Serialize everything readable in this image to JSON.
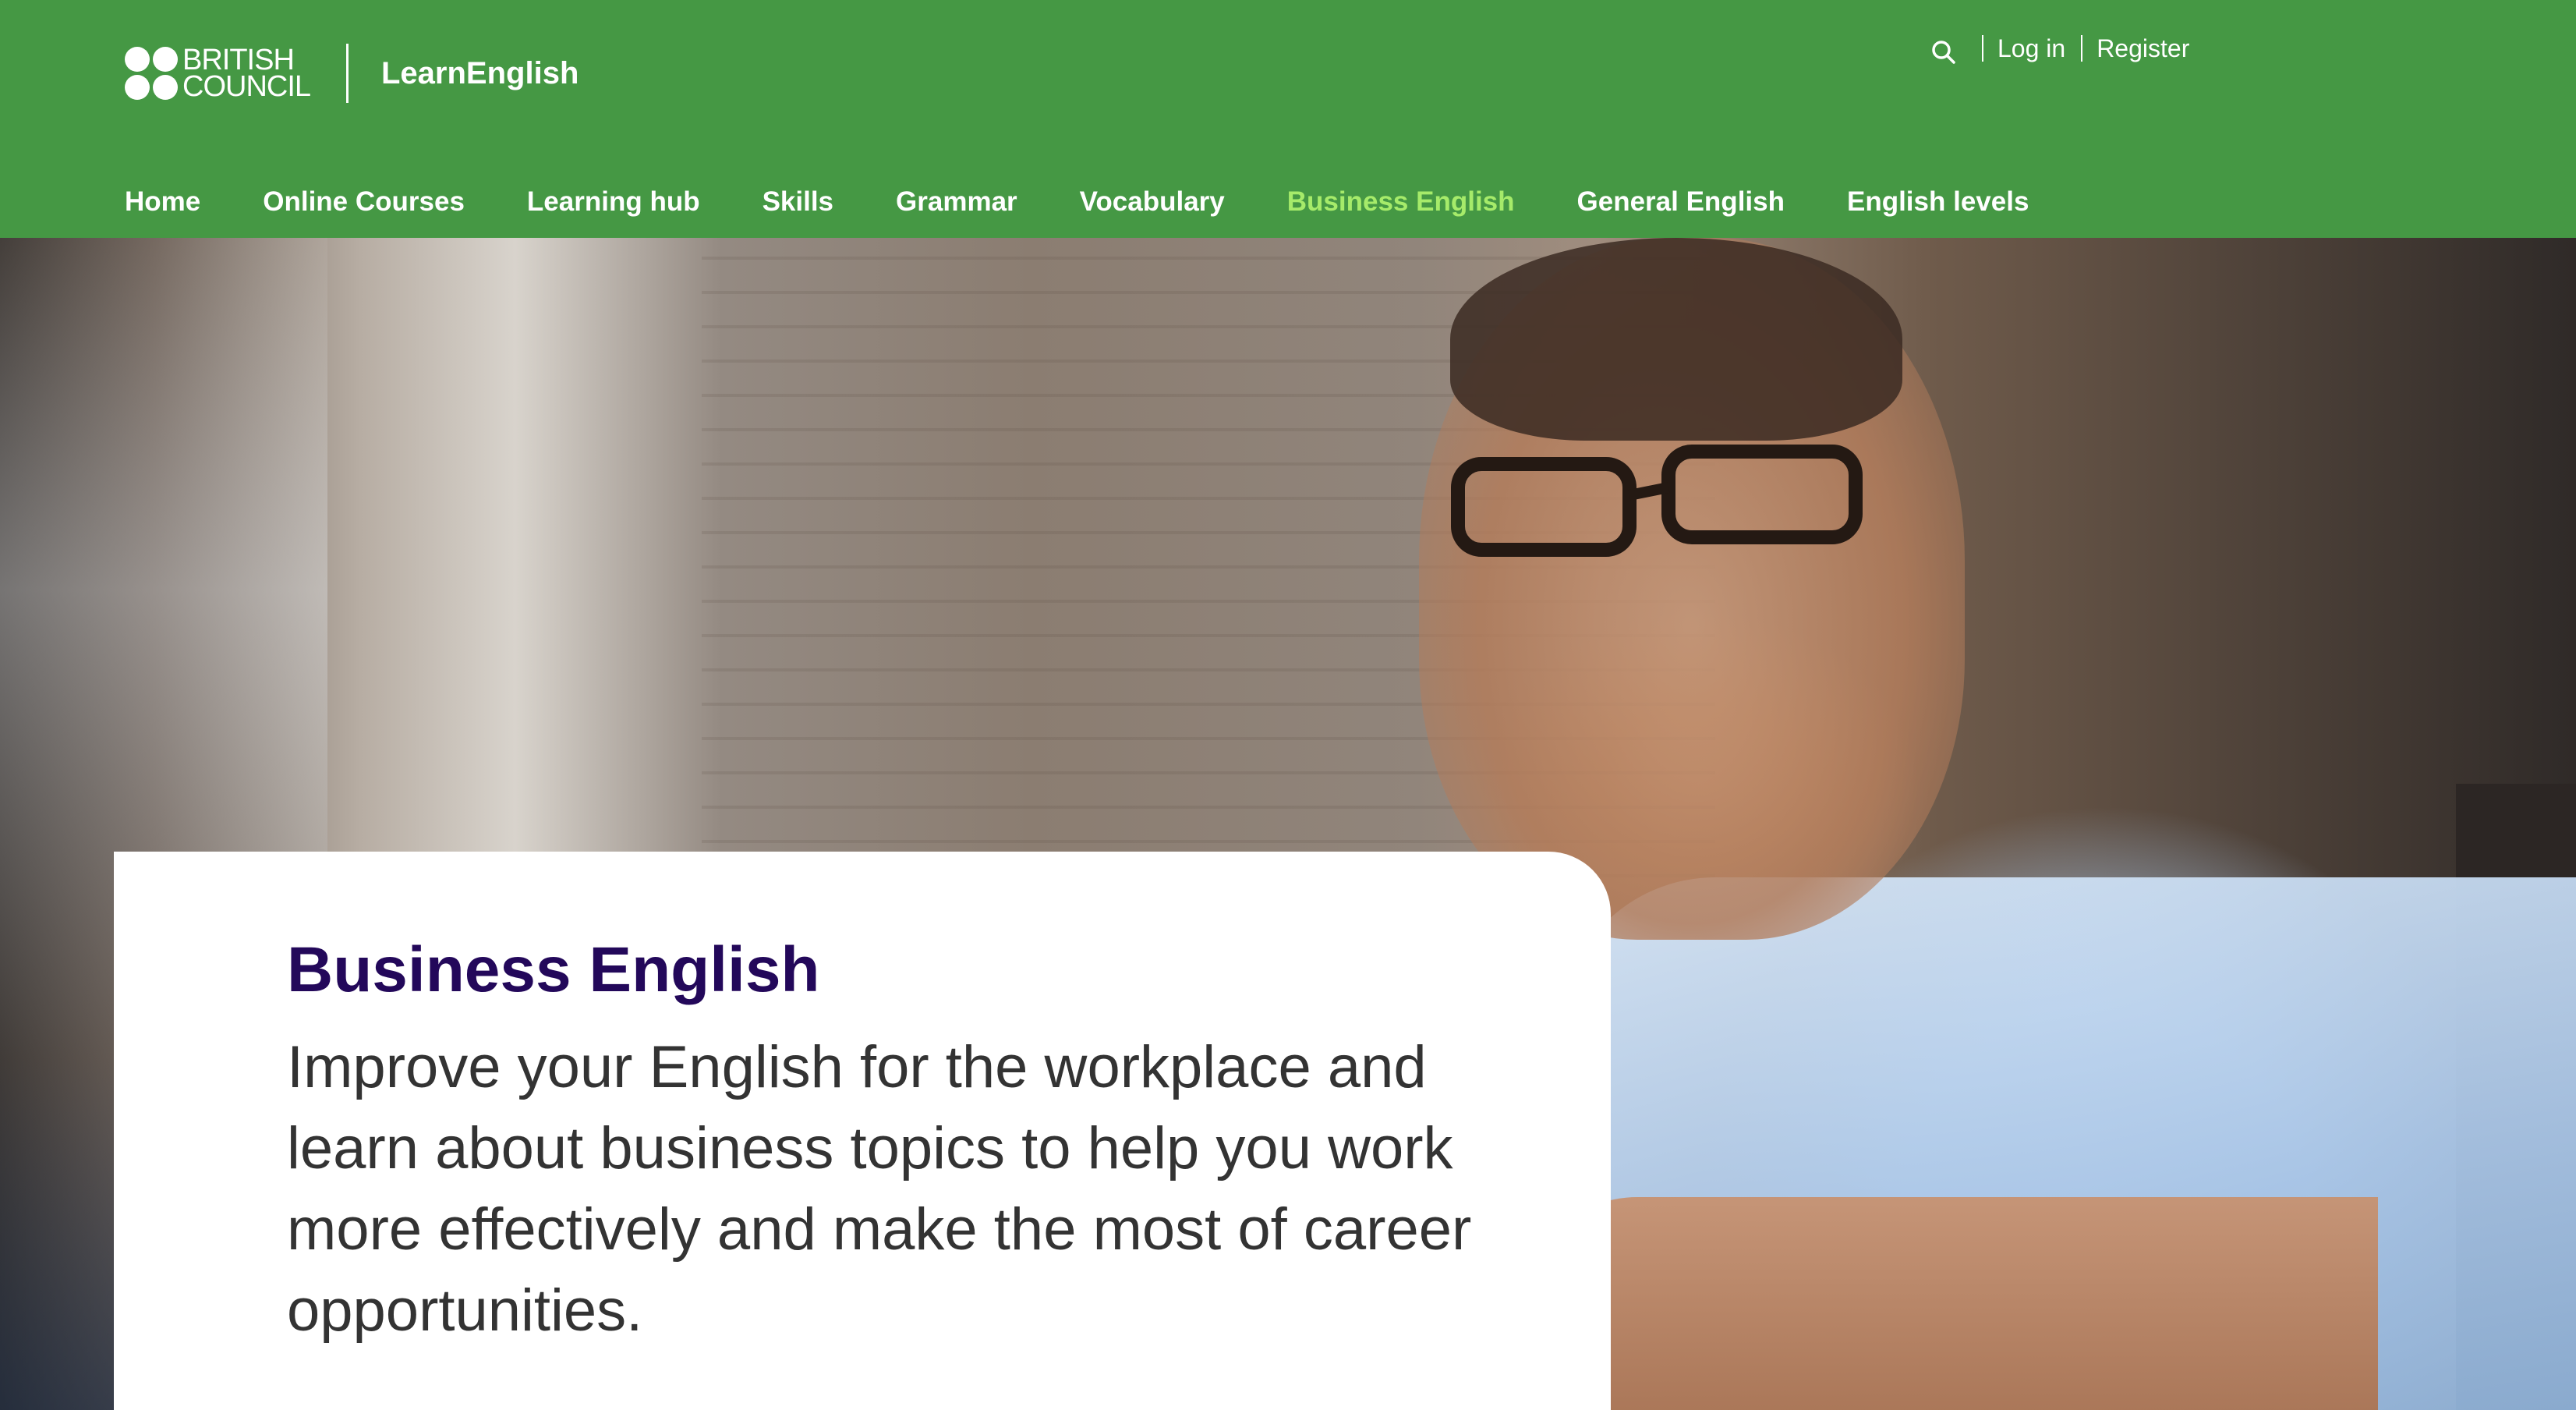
{
  "header": {
    "org_name": "BRITISH\nCOUNCIL",
    "brand": "LearnEnglish",
    "background_color": "#459844",
    "search_icon": "search-icon",
    "login_label": "Log in",
    "register_label": "Register"
  },
  "nav": {
    "items": [
      {
        "label": "Home",
        "active": false
      },
      {
        "label": "Online Courses",
        "active": false
      },
      {
        "label": "Learning hub",
        "active": false
      },
      {
        "label": "Skills",
        "active": false
      },
      {
        "label": "Grammar",
        "active": false
      },
      {
        "label": "Vocabulary",
        "active": false
      },
      {
        "label": "Business English",
        "active": true
      },
      {
        "label": "General English",
        "active": false
      },
      {
        "label": "English levels",
        "active": false
      }
    ],
    "active_color": "#a6eb6a"
  },
  "hero": {
    "title": "Business English",
    "description": "Improve your English for the workplace and learn about business topics to help you work more effectively and make the most of career opportunities.",
    "title_color": "#23085a"
  }
}
